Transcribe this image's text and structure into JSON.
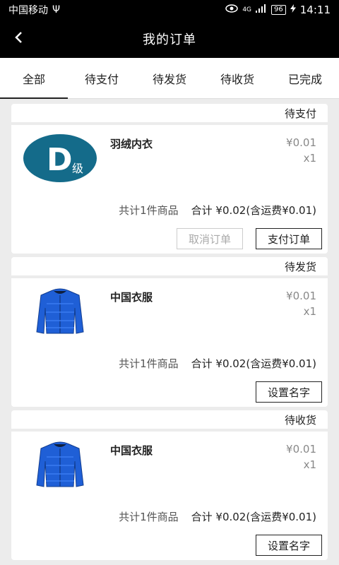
{
  "status_bar": {
    "carrier": "中国移动",
    "usb_symbol": "Ψ",
    "network": "4G",
    "battery": "96",
    "time": "14:11"
  },
  "header": {
    "title": "我的订单",
    "back_icon": "chevron-left-icon"
  },
  "tabs": [
    {
      "label": "全部",
      "active": true
    },
    {
      "label": "待支付",
      "active": false
    },
    {
      "label": "待发货",
      "active": false
    },
    {
      "label": "待收货",
      "active": false
    },
    {
      "label": "已完成",
      "active": false
    }
  ],
  "orders": [
    {
      "status": "待支付",
      "image": "grade-d-badge",
      "badge_letter": "D",
      "badge_text": "级",
      "badge_color": "#146b8a",
      "name": "羽绒内衣",
      "price": "¥0.01",
      "qty": "x1",
      "count_text": "共计1件商品",
      "total_text": "合计 ¥0.02(含运费¥0.01)",
      "buttons": [
        {
          "label": "取消订单",
          "disabled": true
        },
        {
          "label": "支付订单",
          "disabled": false
        }
      ]
    },
    {
      "status": "待发货",
      "image": "blue-down-jacket",
      "name": "中国衣服",
      "price": "¥0.01",
      "qty": "x1",
      "count_text": "共计1件商品",
      "total_text": "合计 ¥0.02(含运费¥0.01)",
      "buttons": [
        {
          "label": "设置名字",
          "disabled": false
        }
      ]
    },
    {
      "status": "待收货",
      "image": "blue-down-jacket",
      "name": "中国衣服",
      "price": "¥0.01",
      "qty": "x1",
      "count_text": "共计1件商品",
      "total_text": "合计 ¥0.02(含运费¥0.01)",
      "buttons": [
        {
          "label": "设置名字",
          "disabled": false
        }
      ]
    }
  ],
  "colors": {
    "header_bg": "#000000",
    "page_bg": "#ececec",
    "jacket_blue": "#1f5fd6"
  }
}
